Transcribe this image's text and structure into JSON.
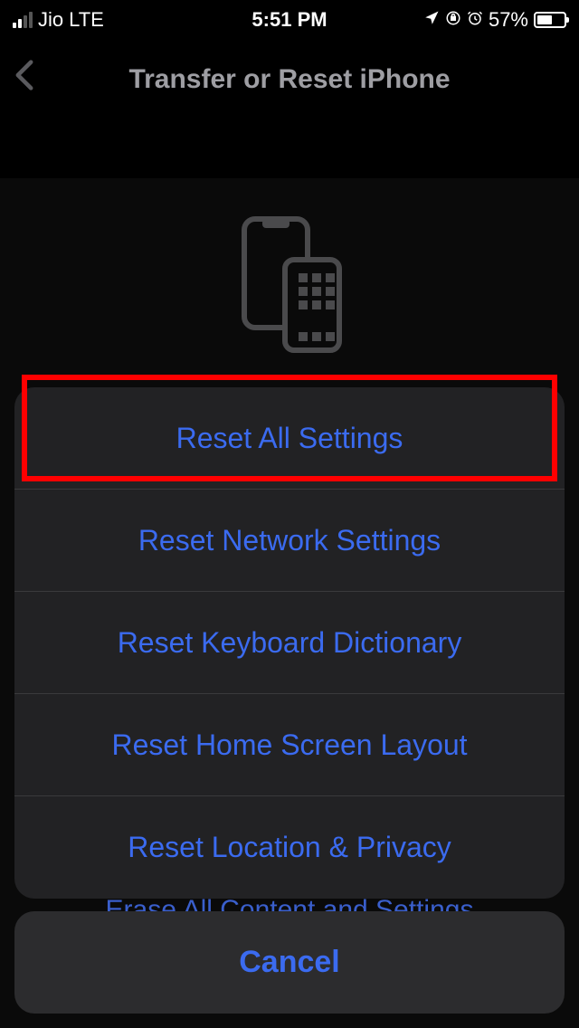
{
  "statusBar": {
    "carrier": "Jio",
    "network": "LTE",
    "time": "5:51 PM",
    "batteryPercent": "57%"
  },
  "nav": {
    "title": "Transfer or Reset iPhone"
  },
  "background": {
    "obscuredOption": "Erase All Content and Settings"
  },
  "actionSheet": {
    "options": [
      "Reset All Settings",
      "Reset Network Settings",
      "Reset Keyboard Dictionary",
      "Reset Home Screen Layout",
      "Reset Location & Privacy"
    ],
    "cancel": "Cancel"
  },
  "highlight": {
    "targetIndex": 0
  }
}
